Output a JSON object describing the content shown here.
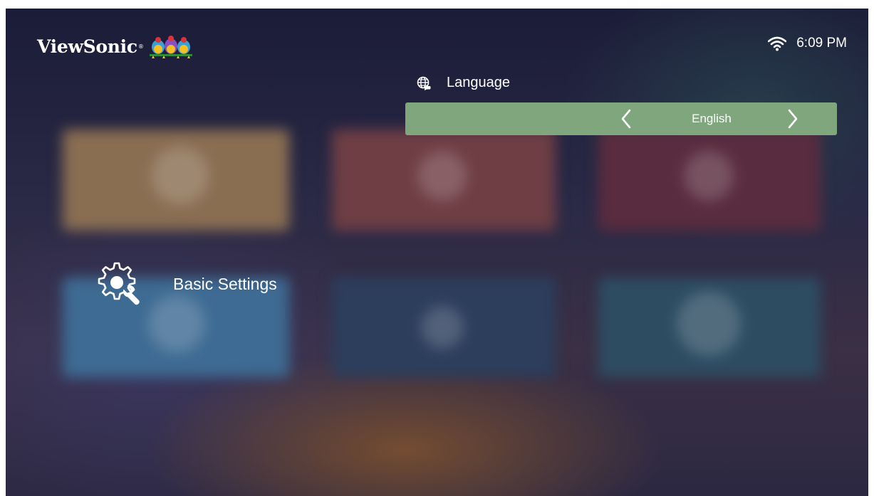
{
  "header": {
    "brand": "ViewSonic",
    "brand_mark": "®",
    "time": "6:09 PM",
    "wifi_icon": "wifi-icon"
  },
  "setting": {
    "icon": "globe-icon",
    "title": "Language",
    "value": "English",
    "prev_icon": "chevron-left-icon",
    "next_icon": "chevron-right-icon"
  },
  "category": {
    "icon": "gear-settings-icon",
    "label": "Basic Settings"
  },
  "colors": {
    "selector_bg": "#7fa67c",
    "text": "#ffffff"
  }
}
